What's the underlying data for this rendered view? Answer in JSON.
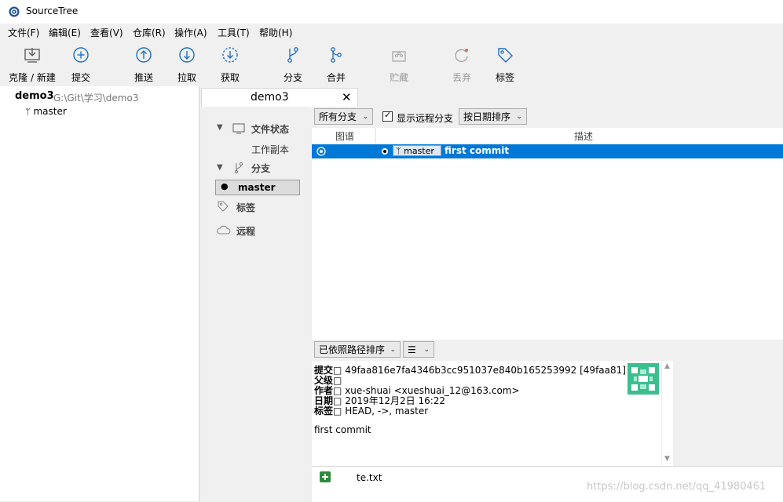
{
  "window": {
    "title": "SourceTree"
  },
  "menu": [
    "文件(F)",
    "编辑(E)",
    "查看(V)",
    "仓库(R)",
    "操作(A)",
    "工具(T)",
    "帮助(H)"
  ],
  "toolbar": {
    "clone": "克隆 / 新建",
    "commit": "提交",
    "push": "推送",
    "pull": "拉取",
    "fetch": "获取",
    "branch": "分支",
    "merge": "合并",
    "stash": "贮藏",
    "discard": "丢弃",
    "tag": "标签"
  },
  "repo": {
    "name": "demo3",
    "path": "G:\\Git\\学习\\demo3",
    "branch": "master"
  },
  "tab": {
    "title": "demo3",
    "close": "✕"
  },
  "nav": {
    "file_status": "文件状态",
    "working_copy": "工作副本",
    "branches": "分支",
    "current_branch": "master",
    "tags": "标签",
    "remotes": "远程"
  },
  "commit_toolbar": {
    "branch_filter": "所有分支",
    "show_remote_label": "显示远程分支",
    "show_remote_checked": true,
    "sort": "按日期排序"
  },
  "columns": {
    "graph": "图谱",
    "description": "描述"
  },
  "commits": [
    {
      "branch_label": "master",
      "message": "first commit",
      "selected": true
    }
  ],
  "detail_toolbar": {
    "sort": "已依照路径排序",
    "view_icon": "list-icon"
  },
  "detail": {
    "commit_label": "提交",
    "commit_value": "49faa816e7fa4346b3cc951037e840b165253992 [49faa81]",
    "parent_label": "父级",
    "author_label": "作者",
    "author_value": "xue-shuai <xueshuai_12@163.com>",
    "date_label": "日期",
    "date_value": "2019年12月2日 16:22",
    "tags_label": "标签",
    "tags_value": "HEAD, ->, master",
    "message": "first commit",
    "sep": "□"
  },
  "files": [
    {
      "name": "te.txt",
      "status": "added"
    }
  ],
  "watermark": "https://blog.csdn.net/qq_41980461",
  "colors": {
    "selection": "#0078d7",
    "accent_icon": "#1f6fbf",
    "added": "#2e8b3a",
    "avatar": "#3bbf8f"
  }
}
